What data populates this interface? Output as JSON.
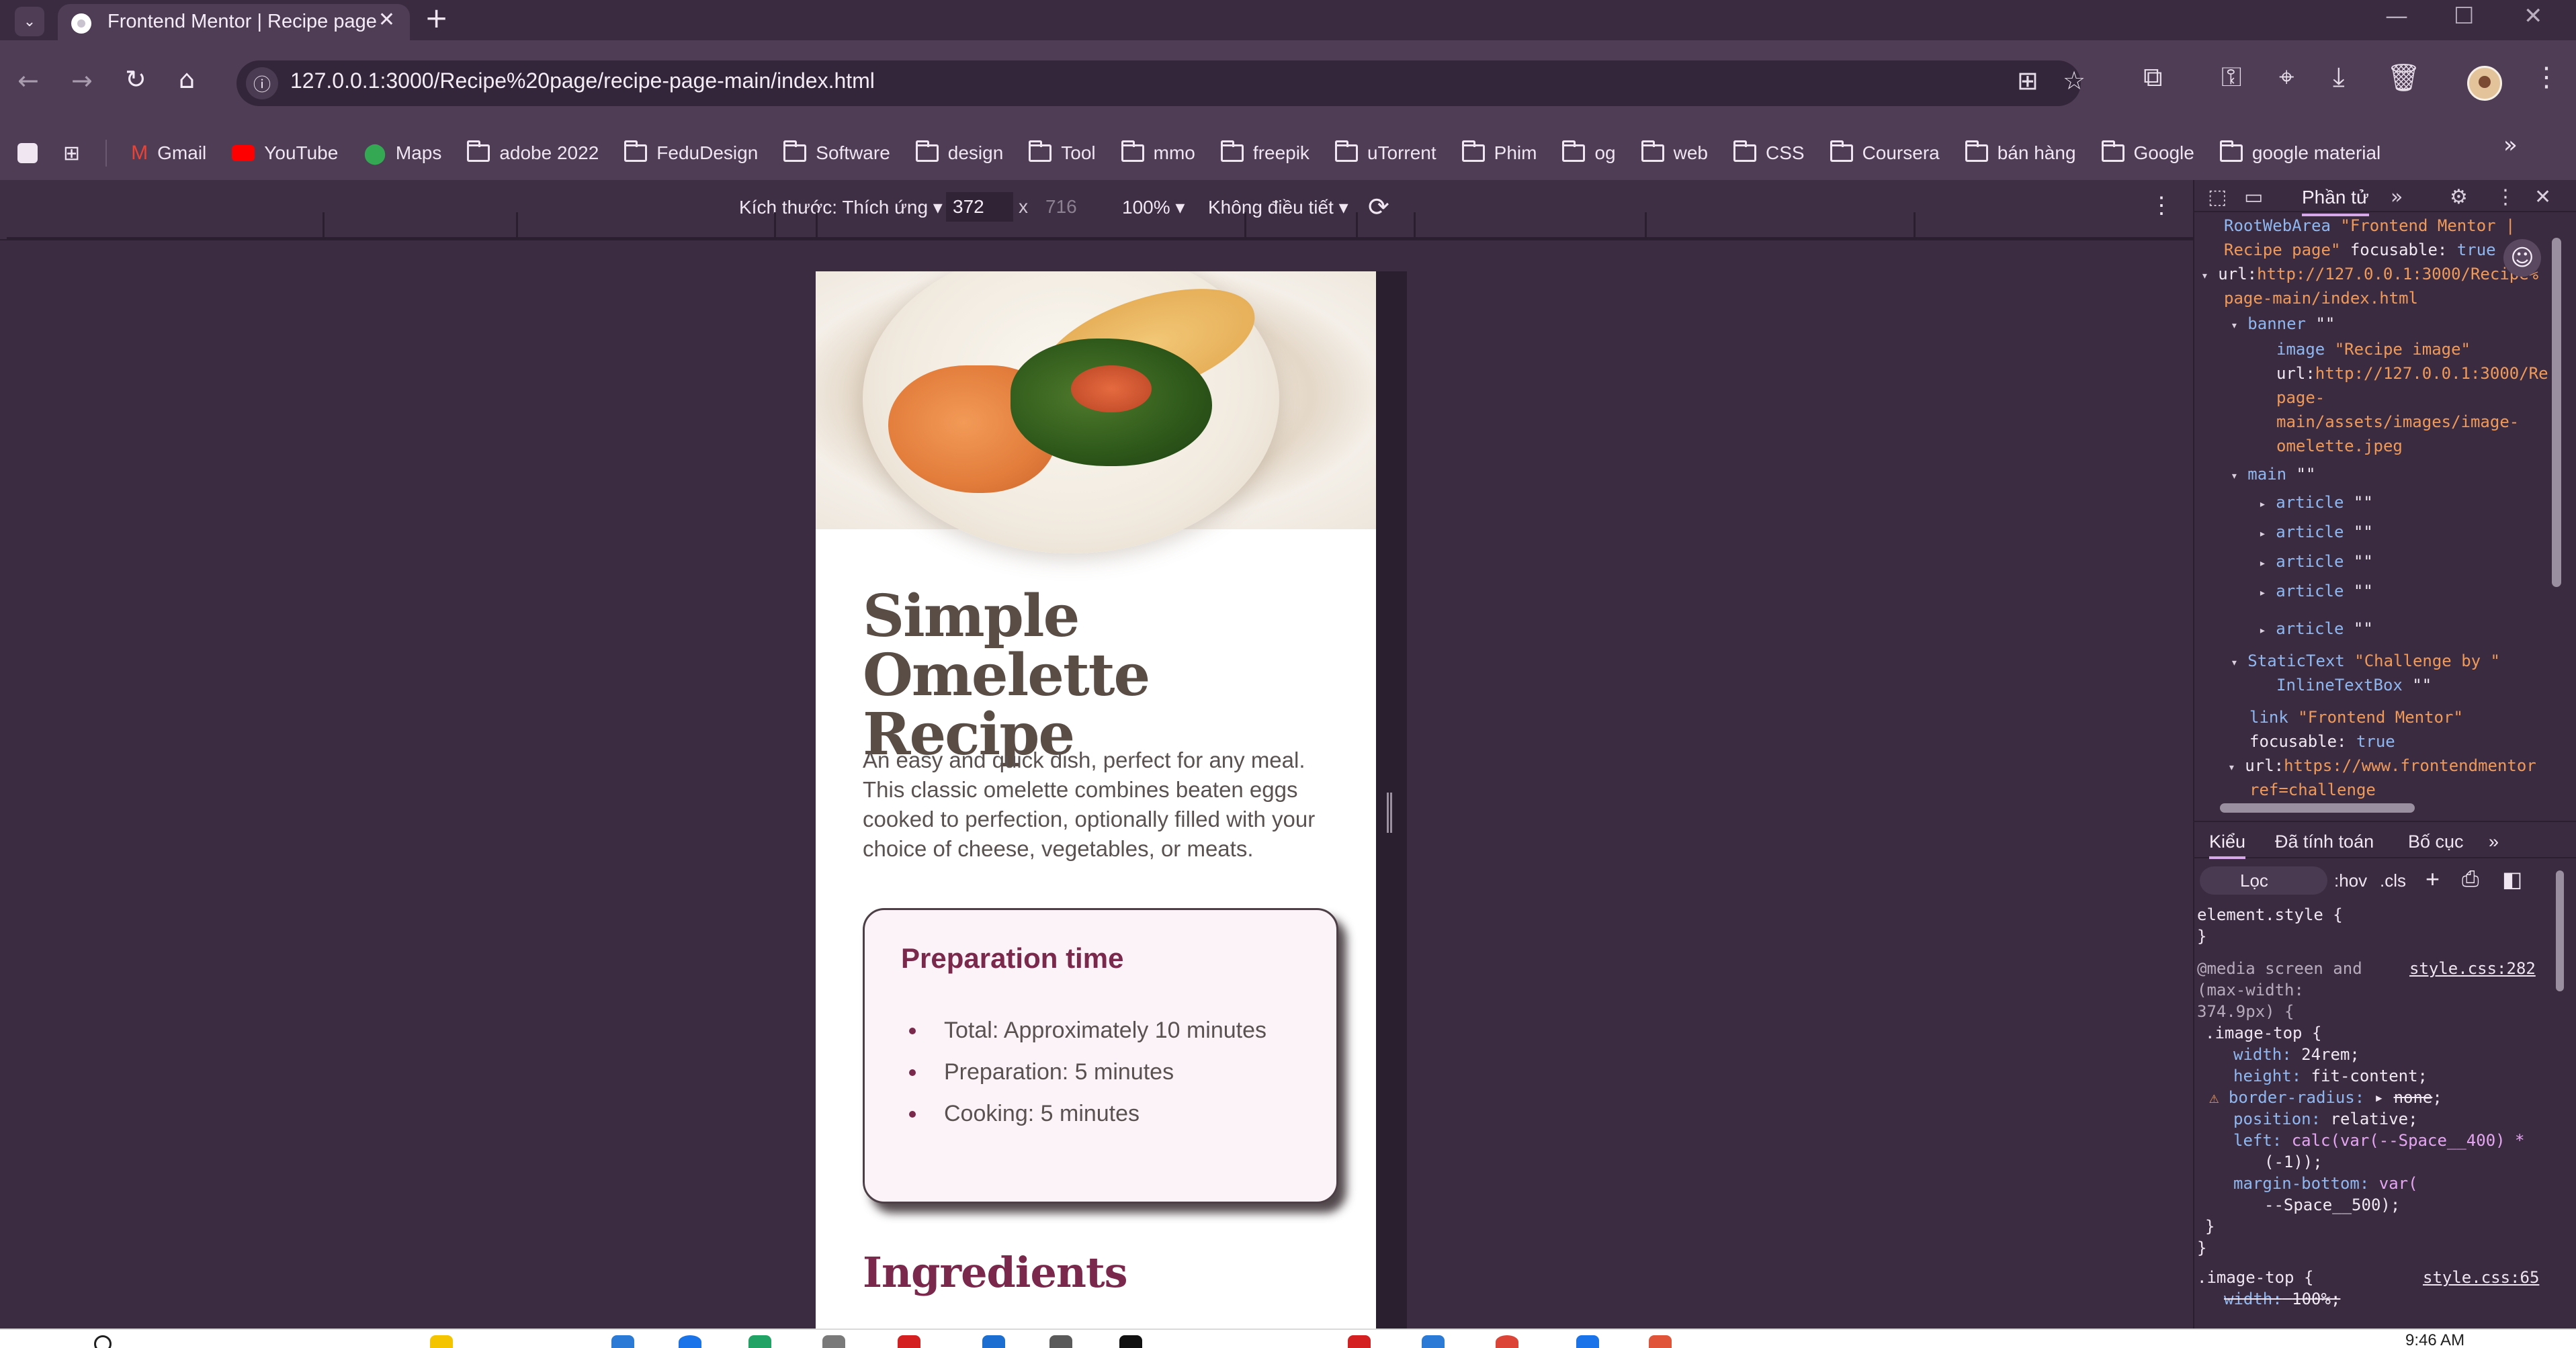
{
  "browser": {
    "tab_title": "Frontend Mentor | Recipe page",
    "url": "127.0.0.1:3000/Recipe%20page/recipe-page-main/index.html",
    "bookmarks": [
      {
        "label": "Gmail",
        "icon": "gmail-icon"
      },
      {
        "label": "YouTube",
        "icon": "youtube-icon"
      },
      {
        "label": "Maps",
        "icon": "maps-icon"
      },
      {
        "label": "adobe 2022",
        "icon": "folder-icon"
      },
      {
        "label": "FeduDesign",
        "icon": "folder-icon"
      },
      {
        "label": "Software",
        "icon": "folder-icon"
      },
      {
        "label": "design",
        "icon": "folder-icon"
      },
      {
        "label": "Tool",
        "icon": "folder-icon"
      },
      {
        "label": "mmo",
        "icon": "folder-icon"
      },
      {
        "label": "freepik",
        "icon": "folder-icon"
      },
      {
        "label": "uTorrent",
        "icon": "folder-icon"
      },
      {
        "label": "Phim",
        "icon": "folder-icon"
      },
      {
        "label": "og",
        "icon": "folder-icon"
      },
      {
        "label": "web",
        "icon": "folder-icon"
      },
      {
        "label": "CSS",
        "icon": "folder-icon"
      },
      {
        "label": "Coursera",
        "icon": "folder-icon"
      },
      {
        "label": "bán hàng",
        "icon": "folder-icon"
      },
      {
        "label": "Google",
        "icon": "folder-icon"
      },
      {
        "label": "google material",
        "icon": "folder-icon"
      }
    ]
  },
  "device_toolbar": {
    "size_label": "Kích thước: Thích ứng",
    "width": "372",
    "times": "x",
    "height": "716",
    "zoom": "100%",
    "throttle": "Không điều tiết"
  },
  "recipe": {
    "title_line1": "Simple",
    "title_line2": "Omelette Recipe",
    "description": "An easy and quick dish, perfect for any meal. This classic omelette combines beaten eggs cooked to perfection, optionally filled with your choice of cheese, vegetables, or meats.",
    "prep_title": "Preparation time",
    "prep_items": [
      "Total: Approximately 10 minutes",
      "Preparation: 5 minutes",
      "Cooking: 5 minutes"
    ],
    "ingredients_title": "Ingredients"
  },
  "devtools": {
    "active_tab": "Phần tử",
    "tree": {
      "root_key": "RootWebArea",
      "root_name_1": "\"Frontend Mentor |",
      "root_name_2": "Recipe page\"",
      "focusable_key": "focusable:",
      "focusable_val": "true",
      "url_key": "url:",
      "root_url_1": "http://127.0.0.1:3000/Recipe%",
      "root_url_2": "page-main/index.html",
      "banner": "banner",
      "empty": "\"\"",
      "image_key": "image",
      "image_name": "\"Recipe image\"",
      "image_url_1": "http://127.0.0.1:3000/Re",
      "image_url_2": "page-",
      "image_url_3": "main/assets/images/image-",
      "image_url_4": "omelette.jpeg",
      "main": "main",
      "article": "article",
      "static_key": "StaticText",
      "static_name": "\"Challenge by \"",
      "inline_key": "InlineTextBox",
      "link_key": "link",
      "link_name": "\"Frontend Mentor\"",
      "link_url_1": "https://www.frontendmentor",
      "link_url_2": "ref=challenge"
    },
    "styles_tabs": [
      "Kiểu",
      "Đã tính toán",
      "Bố cục"
    ],
    "filter_placeholder": "Lọc",
    "hov": ":hov",
    "cls": ".cls",
    "css": {
      "element_style": "element.style {",
      "close": "}",
      "media_1": "@media screen and",
      "media_2": "(max-width:",
      "media_3": "374.9px) {",
      "src_1": "style.css:282",
      "selector": ".image-top {",
      "width_p": "width:",
      "width_v": "24rem;",
      "height_p": "height:",
      "height_v": "fit-content;",
      "radius_p": "border-radius:",
      "radius_v": "none",
      "position_p": "position:",
      "position_v": "relative;",
      "left_p": "left:",
      "left_v1": "calc(var(--Space__400) *",
      "left_v2": "(-1));",
      "mb_p": "margin-bottom:",
      "mb_v1": "var(",
      "mb_v2": "--Space__500);",
      "selector2": ".image-top {",
      "src_2": "style.css:65",
      "width2_p": "width:",
      "width2_v": "100%;"
    }
  },
  "taskbar": {
    "clock": "9:46 AM"
  },
  "colors": {
    "page_bg": "#3c2c42",
    "accent_rose": "#7a284b",
    "heading_brown": "#5a4d45",
    "prep_bg": "#fcf3f8"
  }
}
